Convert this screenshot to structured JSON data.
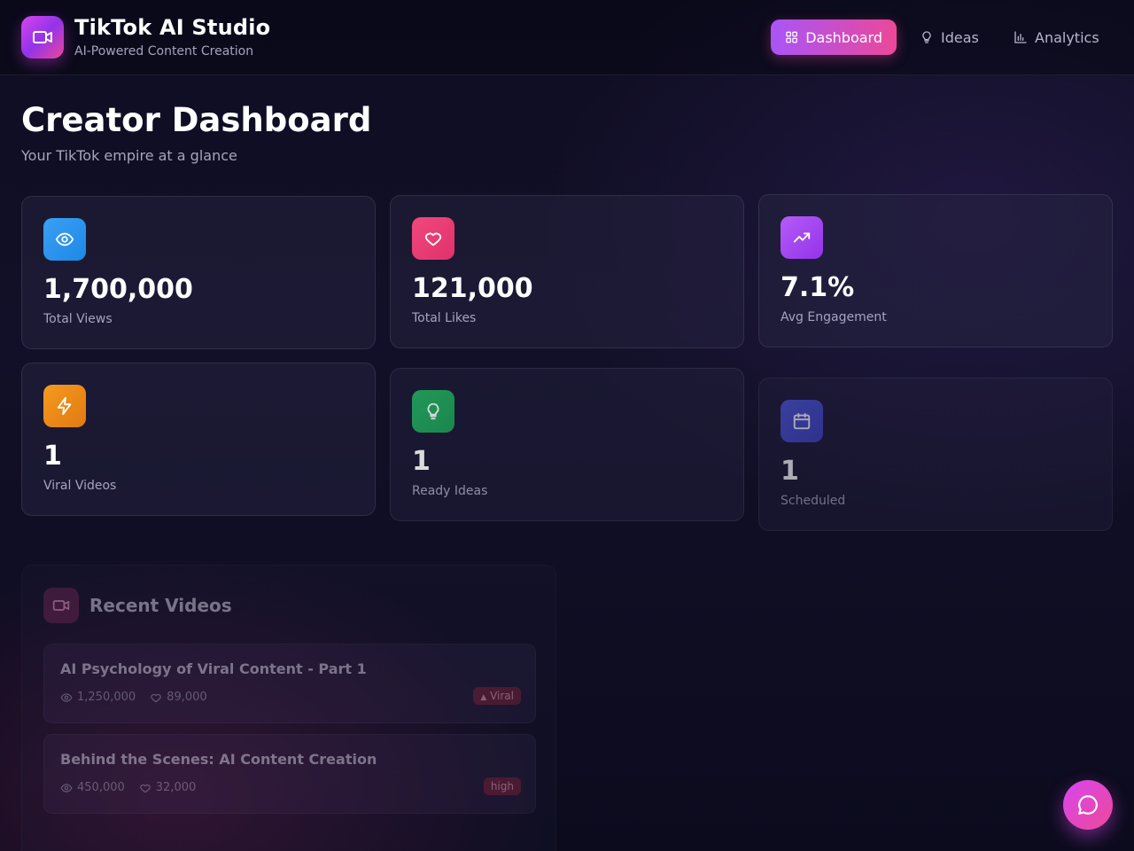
{
  "header": {
    "title": "TikTok AI Studio",
    "subtitle": "AI-Powered Content Creation",
    "logo_icon": "video-camera-icon",
    "nav": [
      {
        "label": "Dashboard",
        "icon": "grid-icon",
        "active": true
      },
      {
        "label": "Ideas",
        "icon": "lightbulb-icon",
        "active": false
      },
      {
        "label": "Analytics",
        "icon": "bar-chart-icon",
        "active": false
      }
    ]
  },
  "page": {
    "title": "Creator Dashboard",
    "subtitle": "Your TikTok empire at a glance"
  },
  "stats": [
    {
      "value": "1,700,000",
      "label": "Total Views",
      "icon": "eye-icon",
      "color": "#2aa7f0"
    },
    {
      "value": "121,000",
      "label": "Total Likes",
      "icon": "heart-icon",
      "color": "#ec4899"
    },
    {
      "value": "7.1%",
      "label": "Avg Engagement",
      "icon": "trending-up-icon",
      "color": "#a855f7"
    },
    {
      "value": "1",
      "label": "Viral Videos",
      "icon": "lightning-icon",
      "color": "#f08a1a"
    },
    {
      "value": "1",
      "label": "Ready Ideas",
      "icon": "lightbulb-icon",
      "color": "#22a55a"
    },
    {
      "value": "1",
      "label": "Scheduled",
      "icon": "calendar-icon",
      "color": "#4f55d6"
    }
  ],
  "recent_videos": {
    "title": "Recent Videos",
    "icon": "video-camera-icon",
    "items": [
      {
        "title": "AI Psychology of Viral Content - Part 1",
        "views": "1,250,000",
        "likes": "89,000",
        "badge": "Viral"
      },
      {
        "title": "Behind the Scenes: AI Content Creation",
        "views": "450,000",
        "likes": "32,000",
        "badge": "high"
      }
    ]
  },
  "chat": {
    "icon": "chat-bubble-icon"
  }
}
